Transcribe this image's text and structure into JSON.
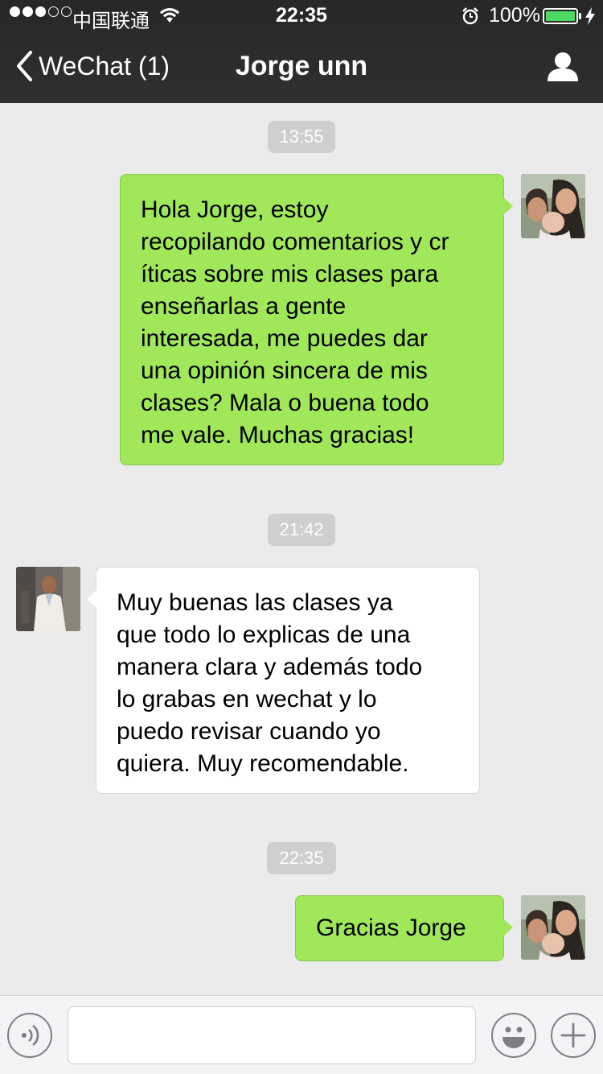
{
  "status_bar": {
    "carrier": "中国联通",
    "time": "22:35",
    "battery": "100%"
  },
  "nav": {
    "back_label": "WeChat (1)",
    "title": "Jorge unn"
  },
  "messages": [
    {
      "type": "time",
      "text": "13:55"
    },
    {
      "type": "sent",
      "lines": [
        "Hola Jorge, estoy",
        "recopilando comentarios y cr",
        "íticas sobre mis clases para",
        "enseñarlas a gente",
        "interesada, me puedes dar",
        "una opinión sincera de mis",
        "clases? Mala o buena todo",
        "me vale. Muchas gracias!"
      ]
    },
    {
      "type": "time",
      "text": "21:42"
    },
    {
      "type": "received",
      "lines": [
        "Muy buenas las clases ya",
        "que todo lo explicas de una",
        "manera clara y además todo",
        "lo grabas en wechat y lo",
        "puedo revisar cuando yo",
        "quiera. Muy recomendable."
      ]
    },
    {
      "type": "time",
      "text": "22:35"
    },
    {
      "type": "sent",
      "lines": [
        "Gracias Jorge"
      ]
    }
  ],
  "input": {
    "value": ""
  },
  "colors": {
    "sent_bubble": "#a0e75a",
    "received_bubble": "#ffffff",
    "chat_background": "#ebebeb",
    "nav_background": "#2e2f31"
  },
  "icons": {
    "back": "chevron-left-icon",
    "contact": "person-icon",
    "voice": "voice-icon",
    "emoji": "emoji-icon",
    "more": "plus-icon"
  }
}
